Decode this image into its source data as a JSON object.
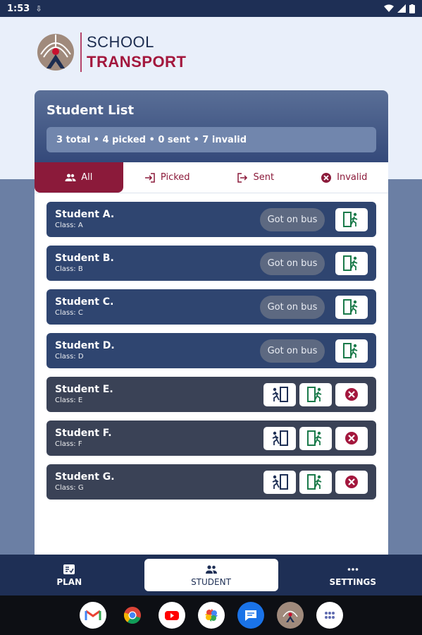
{
  "status_bar": {
    "time": "1:53"
  },
  "app": {
    "title_line1": "SCHOOL",
    "title_line2": "TRANSPORT"
  },
  "card": {
    "title": "Student List",
    "summary": "3 total • 4 picked • 0 sent • 7 invalid"
  },
  "tabs": [
    {
      "label": "All",
      "icon": "group-icon",
      "active": true
    },
    {
      "label": "Picked",
      "icon": "login-icon"
    },
    {
      "label": "Sent",
      "icon": "exit-icon"
    },
    {
      "label": "Invalid",
      "icon": "cancel-icon"
    }
  ],
  "students": [
    {
      "name": "Student A.",
      "class": "Class: A",
      "button": "Got on bus"
    },
    {
      "name": "Student B.",
      "class": "Class: B",
      "button": "Got on bus"
    },
    {
      "name": "Student C.",
      "class": "Class: C",
      "button": "Got on bus"
    },
    {
      "name": "Student D.",
      "class": "Class: D",
      "button": "Got on bus"
    },
    {
      "name": "Student E.",
      "class": "Class: E"
    },
    {
      "name": "Student F.",
      "class": "Class: F"
    },
    {
      "name": "Student G.",
      "class": "Class: G"
    }
  ],
  "nav": [
    {
      "label": "PLAN",
      "icon": "plan-icon"
    },
    {
      "label": "STUDENT",
      "icon": "group-icon"
    },
    {
      "label": "SETTINGS",
      "icon": "more-icon"
    }
  ],
  "dock": [
    "gmail-icon",
    "chrome-icon",
    "youtube-icon",
    "photos-icon",
    "messages-icon",
    "school-transport-icon",
    "app-drawer-icon"
  ],
  "colors": {
    "navy": "#1e2f55",
    "maroon": "#8b1a3a",
    "green": "#1a7a4a",
    "red": "#a3173d"
  }
}
